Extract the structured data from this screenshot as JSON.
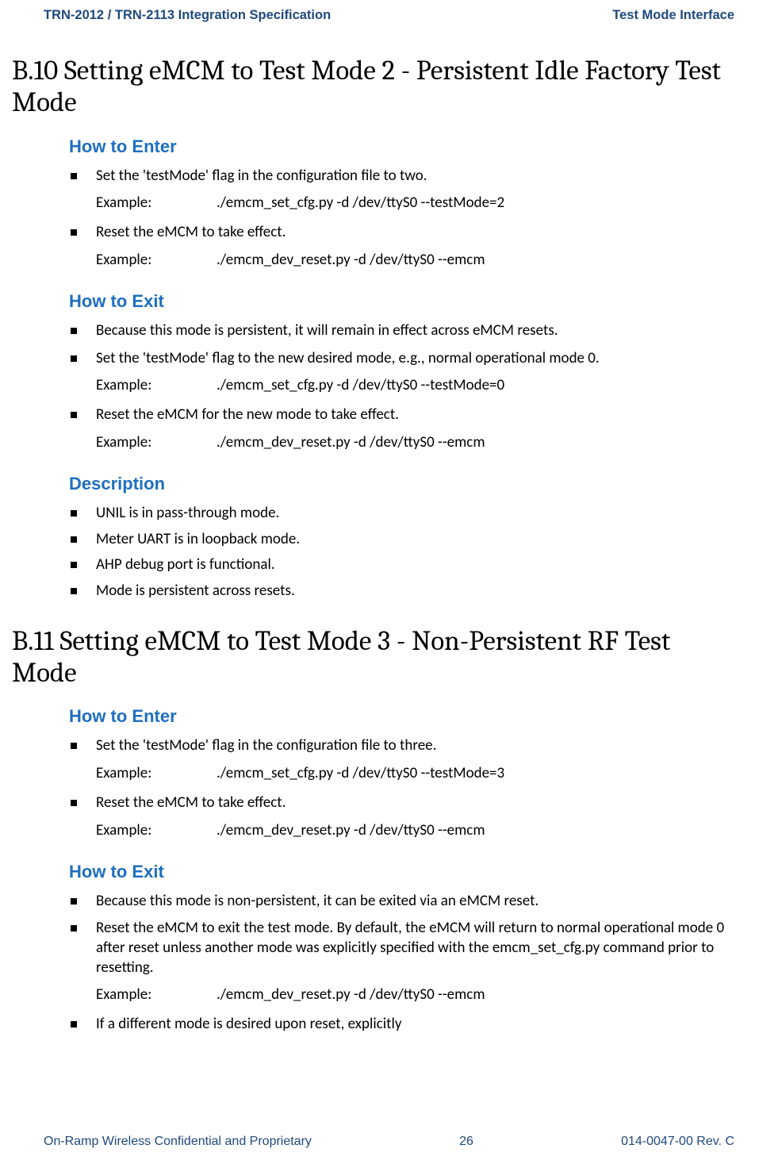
{
  "header": {
    "left": "TRN-2012 / TRN-2113 Integration Specification",
    "right": "Test Mode Interface"
  },
  "sectionB10": {
    "title": "B.10 Setting eMCM to Test Mode 2 - Persistent Idle Factory Test Mode",
    "enter": {
      "heading": "How to Enter",
      "item1": "Set the 'testMode' flag in the configuration file to two.",
      "ex1_label": "Example:",
      "ex1_cmd": "./emcm_set_cfg.py -d /dev/ttyS0 --testMode=2",
      "item2": "Reset the eMCM to take effect.",
      "ex2_label": "Example:",
      "ex2_cmd": "./emcm_dev_reset.py -d /dev/ttyS0 --emcm"
    },
    "exit": {
      "heading": "How to Exit",
      "item1": "Because this mode is persistent, it will remain in effect across eMCM resets.",
      "item2": "Set the 'testMode' flag to the new desired mode, e.g., normal operational mode 0.",
      "ex2_label": "Example:",
      "ex2_cmd": "./emcm_set_cfg.py -d /dev/ttyS0 --testMode=0",
      "item3": "Reset the eMCM for the new mode to take effect.",
      "ex3_label": "Example:",
      "ex3_cmd": "./emcm_dev_reset.py -d /dev/ttyS0 --emcm"
    },
    "desc": {
      "heading": "Description",
      "item1": "UNIL is in pass-through mode.",
      "item2": "Meter UART is in loopback mode.",
      "item3": "AHP debug port is functional.",
      "item4": "Mode is persistent across resets."
    }
  },
  "sectionB11": {
    "title": "B.11 Setting eMCM to Test Mode 3 - Non-Persistent RF Test Mode",
    "enter": {
      "heading": "How to Enter",
      "item1": "Set the 'testMode' flag in the configuration file to three.",
      "ex1_label": "Example:",
      "ex1_cmd": "./emcm_set_cfg.py -d /dev/ttyS0 --testMode=3",
      "item2": "Reset the eMCM to take effect.",
      "ex2_label": "Example:",
      "ex2_cmd": "./emcm_dev_reset.py -d /dev/ttyS0 --emcm"
    },
    "exit": {
      "heading": "How to Exit",
      "item1": "Because this mode is non-persistent, it can be exited via an eMCM reset.",
      "item2": "Reset the eMCM to exit the test mode. By default, the eMCM will return to normal operational mode 0 after reset unless another mode was explicitly specified with the emcm_set_cfg.py command prior to resetting.",
      "ex2_label": "Example:",
      "ex2_cmd": "./emcm_dev_reset.py -d /dev/ttyS0 --emcm",
      "item3": "If a different mode is desired upon reset, explicitly"
    }
  },
  "footer": {
    "left": "On-Ramp Wireless Confidential and Proprietary",
    "center": "26",
    "right": "014-0047-00 Rev. C"
  }
}
